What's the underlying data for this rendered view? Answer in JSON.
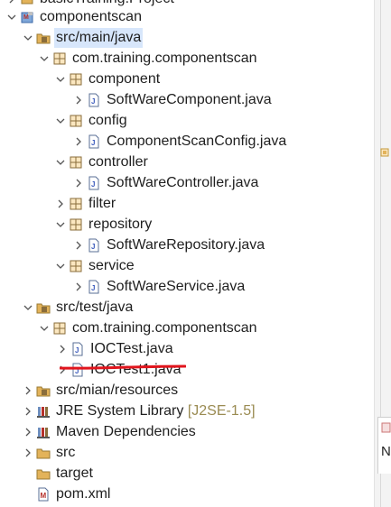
{
  "tree": {
    "rows": [
      {
        "label": "basicTraining.Project",
        "icon": "project-icon"
      },
      {
        "label": "componentscan",
        "icon": "maven-project-icon",
        "expanded": true
      },
      {
        "label": "src/main/java",
        "icon": "source-folder-icon",
        "expanded": true,
        "selected": true
      },
      {
        "label": "com.training.componentscan",
        "icon": "package-icon",
        "expanded": true
      },
      {
        "label": "component",
        "icon": "package-icon",
        "expanded": true
      },
      {
        "label": "SoftWareComponent.java",
        "icon": "java-file-icon"
      },
      {
        "label": "config",
        "icon": "package-icon",
        "expanded": true
      },
      {
        "label": "ComponentScanConfig.java",
        "icon": "java-file-icon"
      },
      {
        "label": "controller",
        "icon": "package-icon",
        "expanded": true
      },
      {
        "label": "SoftWareController.java",
        "icon": "java-file-icon"
      },
      {
        "label": "filter",
        "icon": "package-icon",
        "expanded": false
      },
      {
        "label": "repository",
        "icon": "package-icon",
        "expanded": true
      },
      {
        "label": "SoftWareRepository.java",
        "icon": "java-file-icon"
      },
      {
        "label": "service",
        "icon": "package-icon",
        "expanded": true
      },
      {
        "label": "SoftWareService.java",
        "icon": "java-file-icon"
      },
      {
        "label": "src/test/java",
        "icon": "source-folder-icon",
        "expanded": true
      },
      {
        "label": "com.training.componentscan",
        "icon": "package-icon",
        "expanded": true
      },
      {
        "label": "IOCTest.java",
        "icon": "java-file-icon"
      },
      {
        "label": "IOCTest1.java",
        "icon": "java-file-icon",
        "struck_out": true
      },
      {
        "label": "src/mian/resources",
        "icon": "source-folder-icon",
        "expanded": false
      },
      {
        "label": "JRE System Library",
        "decoration": "[J2SE-1.5]",
        "icon": "library-icon",
        "expanded": false
      },
      {
        "label": "Maven Dependencies",
        "icon": "library-icon",
        "expanded": false
      },
      {
        "label": "src",
        "icon": "folder-icon",
        "expanded": false
      },
      {
        "label": "target",
        "icon": "folder-icon"
      },
      {
        "label": "pom.xml",
        "icon": "xml-file-icon"
      }
    ]
  },
  "side_panel": {
    "tab_letter": "N"
  },
  "colors": {
    "selection": "#d7e6fb",
    "package": "#8a6d3b",
    "java_file": "#3c5bbd",
    "folder": "#e3b35a",
    "annotation_strike": "#e1151d",
    "decoration_text": "#9a8b52"
  }
}
